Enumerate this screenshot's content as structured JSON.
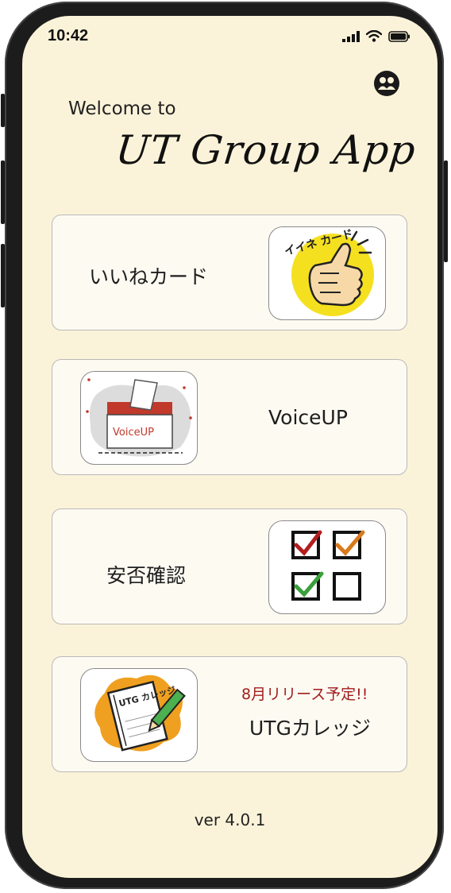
{
  "status_bar": {
    "time": "10:42",
    "icons": [
      "cellular-signal-icon",
      "wifi-icon",
      "battery-icon"
    ]
  },
  "header": {
    "welcome": "Welcome to",
    "app_title": "UT Group App",
    "profile_icon": "profile-icon"
  },
  "menu": [
    {
      "label": "いいねカード",
      "thumb_text": "イイネ カード",
      "icon": "thumbs-up-icon"
    },
    {
      "label": "VoiceUP",
      "thumb_text": "VoiceUP",
      "icon": "ballot-box-icon"
    },
    {
      "label": "安否確認",
      "icon": "checkbox-grid-icon"
    },
    {
      "label": "UTGカレッジ",
      "sub": "8月リリース予定!!",
      "thumb_text": "UTG カレッジ",
      "icon": "notebook-pencil-icon"
    }
  ],
  "footer": {
    "version": "ver 4.0.1"
  },
  "colors": {
    "background": "#fbf3d9",
    "card": "#fdfaf2",
    "accent_red": "#a11d1d",
    "yellow": "#f5e020",
    "orange": "#f0a020"
  }
}
